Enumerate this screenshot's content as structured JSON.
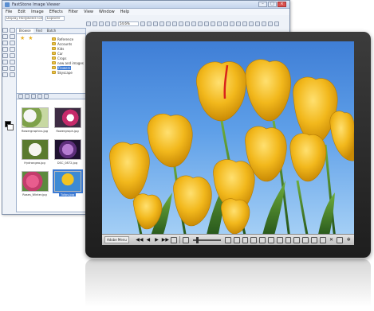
{
  "app": {
    "title": "FastStone Image Viewer",
    "menu": [
      "File",
      "Edit",
      "Image",
      "Effects",
      "Filter",
      "View",
      "Window",
      "Help"
    ],
    "path": "Display Hollyweed Folder...",
    "sub_path": "Explorer",
    "zoom": "54.6%"
  },
  "browser": {
    "tabs": [
      "Browse",
      "Find",
      "Batch"
    ],
    "tree": [
      {
        "label": "Reference"
      },
      {
        "label": "Accounts"
      },
      {
        "label": "Kids"
      },
      {
        "label": "Car"
      },
      {
        "label": "Crops"
      },
      {
        "label": "new and images"
      },
      {
        "label": "Flowers",
        "selected": true
      },
      {
        "label": "Skyscape"
      }
    ],
    "thumbnails": [
      {
        "label": "flowergraphics.jpg",
        "style": "lavender"
      },
      {
        "label": "flowergraph.jpg",
        "style": "pinkflower"
      },
      {
        "label": "Hydrangea.jpg",
        "style": "hydrangea"
      },
      {
        "label": "DSC_0872.jpg",
        "style": "purple"
      },
      {
        "label": "Roses_Winter.jpg",
        "style": "roses"
      },
      {
        "label": "Tulips.jpg",
        "style": "tulipthumb",
        "selected": true
      }
    ]
  },
  "viewer": {
    "menu_label": "Adobe Menu"
  },
  "colors": {
    "tulip": "#f2b81c",
    "sky": "#3f7ed6",
    "device": "#2a2a2a"
  }
}
